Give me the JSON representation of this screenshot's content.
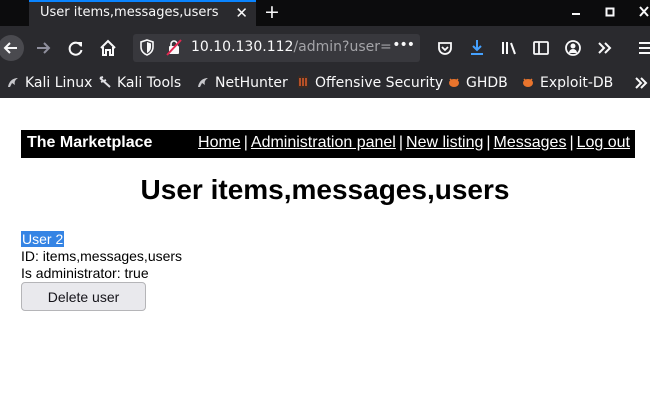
{
  "browser": {
    "tab_title": "User items,messages,users",
    "tab_close": "✕",
    "new_tab": "+",
    "url_host": "10.10.130.112",
    "url_path": "/admin?user=-",
    "url_more": "•••"
  },
  "bookmarks": [
    {
      "label": "Kali Linux"
    },
    {
      "label": "Kali Tools"
    },
    {
      "label": "NetHunter"
    },
    {
      "label": "Offensive Security"
    },
    {
      "label": "GHDB"
    },
    {
      "label": "Exploit-DB"
    }
  ],
  "site": {
    "brand": "The Marketplace",
    "nav": {
      "home": "Home",
      "admin": "Administration panel",
      "new_listing": "New listing",
      "messages": "Messages",
      "logout": "Log out",
      "separator": "|"
    }
  },
  "main": {
    "heading": "User items,messages,users",
    "user_name": "User 2",
    "id_line": "ID: items,messages,users",
    "admin_line": "Is administrator: true",
    "delete_label": "Delete user"
  },
  "colors": {
    "tab_accent": "#0a84ff",
    "toolbar_bg": "#2a2a2e",
    "selection": "#3584e4",
    "download_icon": "#45a1ff"
  }
}
